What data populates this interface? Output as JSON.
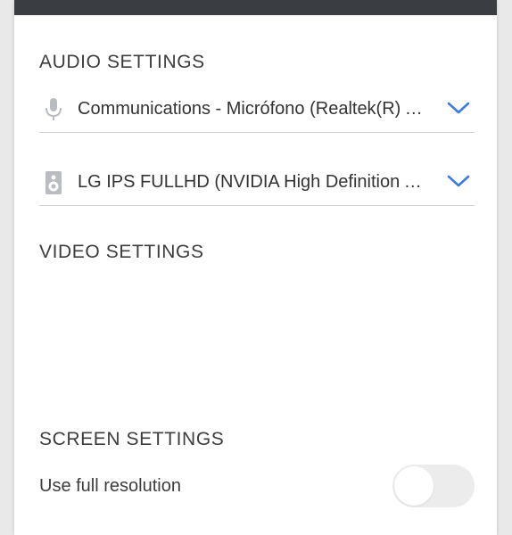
{
  "audio": {
    "title": "AUDIO SETTINGS",
    "microphone": {
      "value": "Communications - Micrófono (Realtek(R) Audio)",
      "icon": "microphone-icon"
    },
    "speaker": {
      "value": "LG IPS FULLHD (NVIDIA High Definition Audio)",
      "icon": "speaker-icon"
    }
  },
  "video": {
    "title": "VIDEO SETTINGS"
  },
  "screen": {
    "title": "SCREEN SETTINGS",
    "full_resolution_label": "Use full resolution",
    "full_resolution_enabled": false
  },
  "colors": {
    "topbar": "#3a3d42",
    "accent": "#3b7ddd",
    "toggle_off": "#ececec"
  }
}
